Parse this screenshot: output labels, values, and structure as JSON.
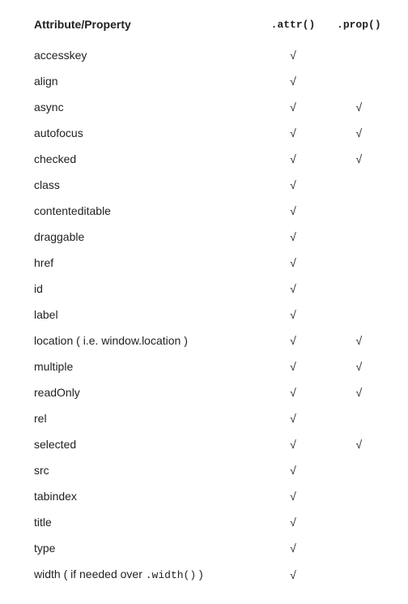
{
  "headers": {
    "attribute": "Attribute/Property",
    "attr_method": ".attr()",
    "prop_method": ".prop()"
  },
  "check_mark": "√",
  "rows": [
    {
      "name": "accesskey",
      "attr": true,
      "prop": false
    },
    {
      "name": "align",
      "attr": true,
      "prop": false
    },
    {
      "name": "async",
      "attr": true,
      "prop": true
    },
    {
      "name": "autofocus",
      "attr": true,
      "prop": true
    },
    {
      "name": "checked",
      "attr": true,
      "prop": true
    },
    {
      "name": "class",
      "attr": true,
      "prop": false
    },
    {
      "name": "contenteditable",
      "attr": true,
      "prop": false
    },
    {
      "name": "draggable",
      "attr": true,
      "prop": false
    },
    {
      "name": "href",
      "attr": true,
      "prop": false
    },
    {
      "name": "id",
      "attr": true,
      "prop": false
    },
    {
      "name": "label",
      "attr": true,
      "prop": false
    },
    {
      "name": "location ( i.e. window.location )",
      "attr": true,
      "prop": true
    },
    {
      "name": "multiple",
      "attr": true,
      "prop": true
    },
    {
      "name": "readOnly",
      "attr": true,
      "prop": true
    },
    {
      "name": "rel",
      "attr": true,
      "prop": false
    },
    {
      "name": "selected",
      "attr": true,
      "prop": true
    },
    {
      "name": "src",
      "attr": true,
      "prop": false
    },
    {
      "name": "tabindex",
      "attr": true,
      "prop": false
    },
    {
      "name": "title",
      "attr": true,
      "prop": false
    },
    {
      "name": "type",
      "attr": true,
      "prop": false
    },
    {
      "name_html": "width ( if needed over <code>.width()</code> )",
      "name": "width ( if needed over .width() )",
      "attr": true,
      "prop": false
    }
  ]
}
